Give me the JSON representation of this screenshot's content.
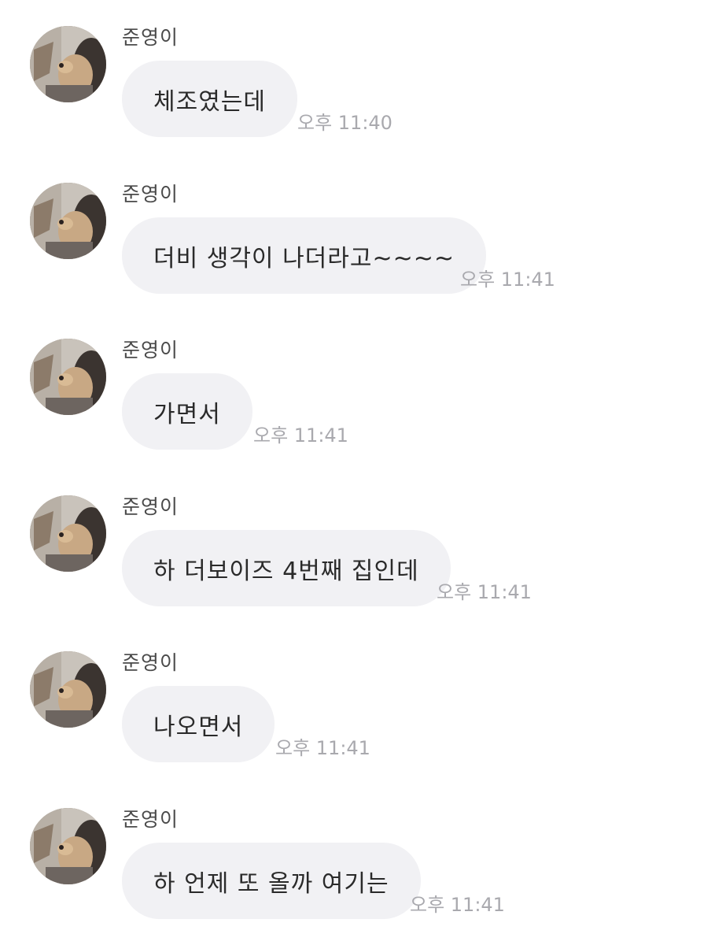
{
  "sender_name": "준영이",
  "messages": [
    {
      "text": "체조였는데",
      "time": "오후 11:40"
    },
    {
      "text": "더비 생각이 나더라고~~~~",
      "time": "오후 11:41"
    },
    {
      "text": "가면서",
      "time": "오후 11:41"
    },
    {
      "text": "하 더보이즈 4번째 집인데",
      "time": "오후 11:41"
    },
    {
      "text": "나오면서",
      "time": "오후 11:41"
    },
    {
      "text": "하 언제 또 올까 여기는",
      "time": "오후 11:41"
    }
  ],
  "colors": {
    "bubble_bg": "#f1f1f4",
    "message_text": "#2a2a2a",
    "sender_text": "#4a4a4a",
    "time_text": "#a9a9ae",
    "background": "#ffffff"
  }
}
